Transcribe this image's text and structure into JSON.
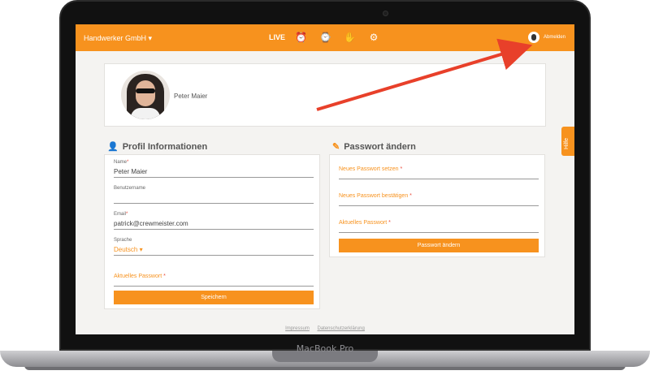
{
  "device": {
    "brand_label": "MacBook Pro"
  },
  "topbar": {
    "company": "Handwerker GmbH ▾",
    "live": "LIVE",
    "icons": [
      "alarm-icon",
      "clock-calendar-icon",
      "handshake-icon",
      "gear-icon"
    ],
    "logout": "Abmelden"
  },
  "profile": {
    "name": "Peter Maier"
  },
  "profile_info": {
    "title": "Profil Informationen",
    "fields": [
      {
        "label": "Name",
        "required": true,
        "value": "Peter Maier"
      },
      {
        "label": "Benutzername",
        "required": false,
        "value": ""
      },
      {
        "label": "Email",
        "required": true,
        "value": "patrick@crewmeister.com"
      },
      {
        "label": "Sprache",
        "required": false,
        "value": "Deutsch ▾"
      },
      {
        "label": "Aktuelles Passwort",
        "required": true,
        "value": ""
      }
    ],
    "save_button": "Speichern"
  },
  "password": {
    "title": "Passwort ändern",
    "fields": [
      {
        "label": "Neues Passwort setzen",
        "required": true
      },
      {
        "label": "Neues Passwort bestätigen",
        "required": true
      },
      {
        "label": "Aktuelles Passwort",
        "required": true
      }
    ],
    "change_button": "Passwort ändern"
  },
  "footer": {
    "impressum": "Impressum",
    "privacy": "Datenschutzerklärung"
  },
  "help_tab": "Hilfe",
  "colors": {
    "accent": "#f7921e",
    "arrow": "#e8402a",
    "required": "#e94c3d"
  }
}
